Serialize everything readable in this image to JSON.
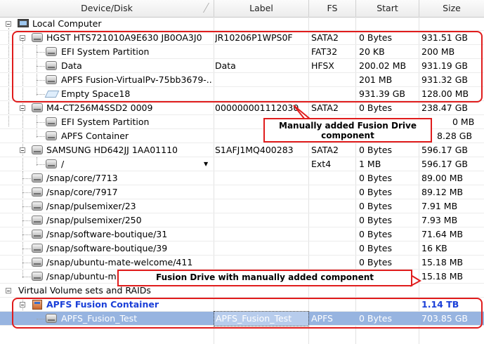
{
  "columns": {
    "device": "Device/Disk",
    "label": "Label",
    "fs": "FS",
    "start": "Start",
    "size": "Size"
  },
  "rows": [
    {
      "name": "Local Computer",
      "label": "",
      "fs": "",
      "start": "",
      "size": ""
    },
    {
      "name": "HGST HTS721010A9E630 JB0OA3J0",
      "label": "JR10206P1WPS0F",
      "fs": "SATA2",
      "start": "0 Bytes",
      "size": "931.51 GB"
    },
    {
      "name": "EFI System Partition",
      "label": "",
      "fs": "FAT32",
      "start": "20 KB",
      "size": "200 MB"
    },
    {
      "name": "Data",
      "label": "Data",
      "fs": "HFSX",
      "start": "200.02 MB",
      "size": "931.19 GB"
    },
    {
      "name": "APFS Fusion-VirtualPv-75bb3679-...",
      "label": "",
      "fs": "",
      "start": "201 MB",
      "size": "931.32 GB"
    },
    {
      "name": "Empty Space18",
      "label": "",
      "fs": "",
      "start": "931.39 GB",
      "size": "128.00 MB"
    },
    {
      "name": "M4-CT256M4SSD2 0009",
      "label": "000000001112030",
      "fs": "SATA2",
      "start": "0 Bytes",
      "size": "238.47 GB"
    },
    {
      "name": "EFI System Partition",
      "label": "",
      "fs": "",
      "start": "",
      "size": "0 MB"
    },
    {
      "name": "APFS Container",
      "label": "",
      "fs": "",
      "start": "",
      "size": "8.28 GB"
    },
    {
      "name": "SAMSUNG HD642JJ 1AA01110",
      "label": "S1AFJ1MQ400283",
      "fs": "SATA2",
      "start": "0 Bytes",
      "size": "596.17 GB"
    },
    {
      "name": "/",
      "label": "",
      "fs": "Ext4",
      "start": "1 MB",
      "size": "596.17 GB"
    },
    {
      "name": "/snap/core/7713",
      "label": "",
      "fs": "",
      "start": "0 Bytes",
      "size": "89.00 MB"
    },
    {
      "name": "/snap/core/7917",
      "label": "",
      "fs": "",
      "start": "0 Bytes",
      "size": "89.12 MB"
    },
    {
      "name": "/snap/pulsemixer/23",
      "label": "",
      "fs": "",
      "start": "0 Bytes",
      "size": "7.91 MB"
    },
    {
      "name": "/snap/pulsemixer/250",
      "label": "",
      "fs": "",
      "start": "0 Bytes",
      "size": "7.93 MB"
    },
    {
      "name": "/snap/software-boutique/31",
      "label": "",
      "fs": "",
      "start": "0 Bytes",
      "size": "71.64 MB"
    },
    {
      "name": "/snap/software-boutique/39",
      "label": "",
      "fs": "",
      "start": "0 Bytes",
      "size": "16 KB"
    },
    {
      "name": "/snap/ubuntu-mate-welcome/411",
      "label": "",
      "fs": "",
      "start": "0 Bytes",
      "size": "15.18 MB"
    },
    {
      "name": "/snap/ubuntu-ma",
      "label": "",
      "fs": "",
      "start": "",
      "size": "15.18 MB"
    },
    {
      "name": "Virtual Volume sets and RAIDs",
      "label": "",
      "fs": "",
      "start": "",
      "size": ""
    },
    {
      "name": "APFS Fusion Container",
      "label": "",
      "fs": "",
      "start": "",
      "size": "1.14 TB"
    },
    {
      "name": "APFS_Fusion_Test",
      "label": "APFS_Fusion_Test",
      "fs": "APFS",
      "start": "0 Bytes",
      "size": "703.85 GB"
    }
  ],
  "annotations": {
    "manual_component": "Manually added Fusion Drive component",
    "fusion_drive": "Fusion Drive with manually added component"
  },
  "colors": {
    "annotation_red": "#e01c1c",
    "selection": "#97b4e0",
    "container_blue": "#1a3fd8"
  }
}
